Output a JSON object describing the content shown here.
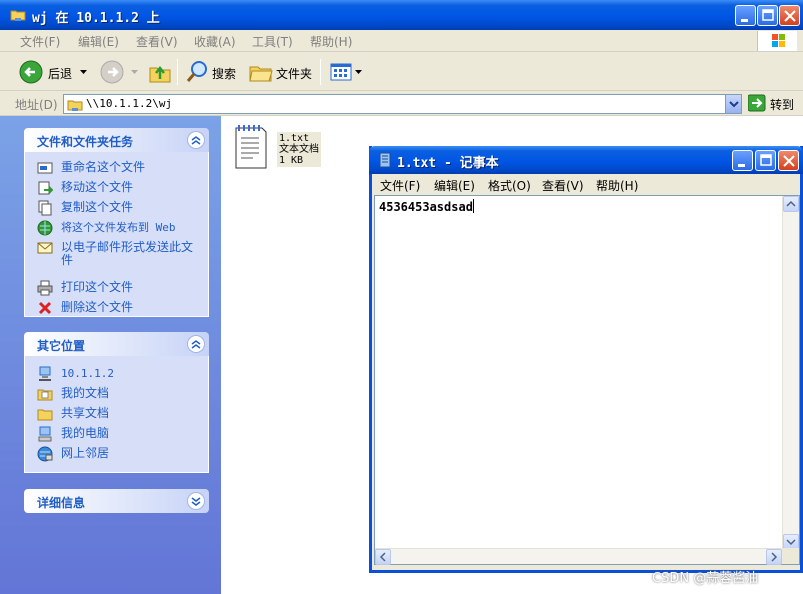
{
  "explorer": {
    "title": "wj 在 10.1.1.2 上",
    "menu": [
      "文件(F)",
      "编辑(E)",
      "查看(V)",
      "收藏(A)",
      "工具(T)",
      "帮助(H)"
    ],
    "toolbar": {
      "back": "后退",
      "search": "搜索",
      "folders": "文件夹"
    },
    "address": {
      "label": "地址(D)",
      "value": "\\\\10.1.1.2\\wj",
      "go": "转到"
    }
  },
  "taskpane": {
    "file_tasks": {
      "title": "文件和文件夹任务",
      "items": [
        "重命名这个文件",
        "移动这个文件",
        "复制这个文件",
        "将这个文件发布到 Web",
        "以电子邮件形式发送此文件",
        "打印这个文件",
        "删除这个文件"
      ]
    },
    "other_places": {
      "title": "其它位置",
      "items": [
        "10.1.1.2",
        "我的文档",
        "共享文档",
        "我的电脑",
        "网上邻居"
      ]
    },
    "details": {
      "title": "详细信息"
    }
  },
  "file": {
    "name": "1.txt",
    "type": "文本文档",
    "size": "1 KB"
  },
  "notepad": {
    "title": "1.txt - 记事本",
    "menu": [
      "文件(F)",
      "编辑(E)",
      "格式(O)",
      "查看(V)",
      "帮助(H)"
    ],
    "content": "4536453asdsad"
  },
  "watermark": "CSDN @蒜蓉酱油"
}
